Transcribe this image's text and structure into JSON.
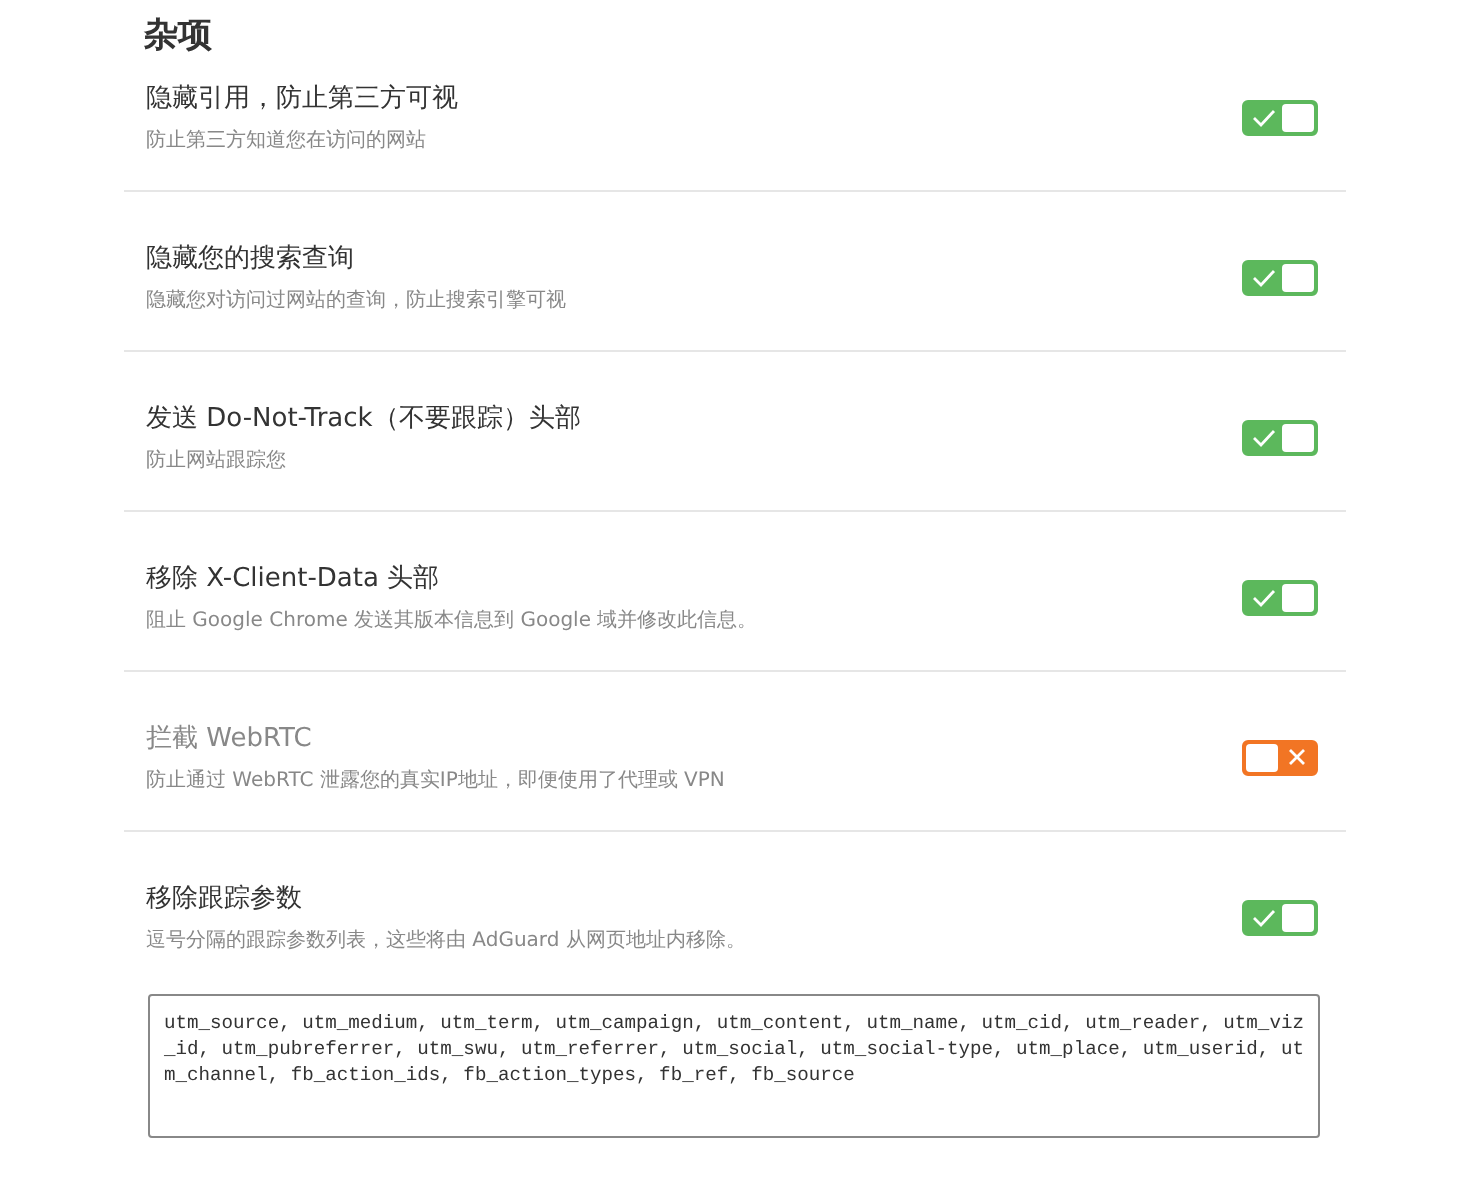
{
  "section": {
    "title": "杂项"
  },
  "settings": [
    {
      "title": "隐藏引用，防止第三方可视",
      "description": "防止第三方知道您在访问的网站",
      "on": true
    },
    {
      "title": "隐藏您的搜索查询",
      "description": "隐藏您对访问过网站的查询，防止搜索引擎可视",
      "on": true
    },
    {
      "title": "发送 Do-Not-Track（不要跟踪）头部",
      "description": "防止网站跟踪您",
      "on": true
    },
    {
      "title": "移除 X-Client-Data 头部",
      "description": "阻止 Google Chrome 发送其版本信息到 Google 域并修改此信息。",
      "on": true
    },
    {
      "title": "拦截 WebRTC",
      "description": "防止通过 WebRTC 泄露您的真实IP地址，即便使用了代理或 VPN",
      "on": false
    },
    {
      "title": "移除跟踪参数",
      "description": "逗号分隔的跟踪参数列表，这些将由 AdGuard 从网页地址内移除。",
      "on": true
    }
  ],
  "tracking_params": {
    "value": "utm_source, utm_medium, utm_term, utm_campaign, utm_content, utm_name, utm_cid, utm_reader, utm_viz_id, utm_pubreferrer, utm_swu, utm_referrer, utm_social, utm_social-type, utm_place, utm_userid, utm_channel, fb_action_ids, fb_action_types, fb_ref, fb_source"
  }
}
